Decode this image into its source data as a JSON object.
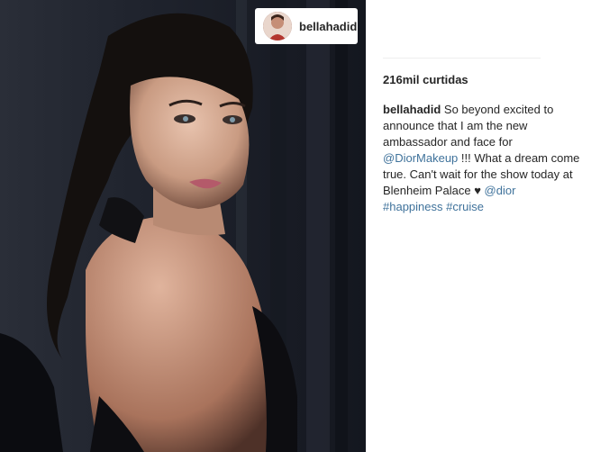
{
  "post": {
    "username": "bellahadid",
    "likes": "216mil curtidas",
    "caption": {
      "author": "bellahadid",
      "text_1": "So beyond excited to announce that I am the new ambassador and face for",
      "mention_1": "@DiorMakeup",
      "text_2": "!!! What a dream come true. Can't wait for the show today at Blenheim Palace",
      "heart": "♥",
      "mention_2": "@dior",
      "hashtag_1": "#happiness",
      "hashtag_2": "#cruise"
    },
    "colors": {
      "link": "#3f729b",
      "text": "#262626",
      "divider": "#efefef"
    },
    "icons": {
      "photo": "portrait-photo",
      "avatar": "profile-avatar"
    }
  }
}
